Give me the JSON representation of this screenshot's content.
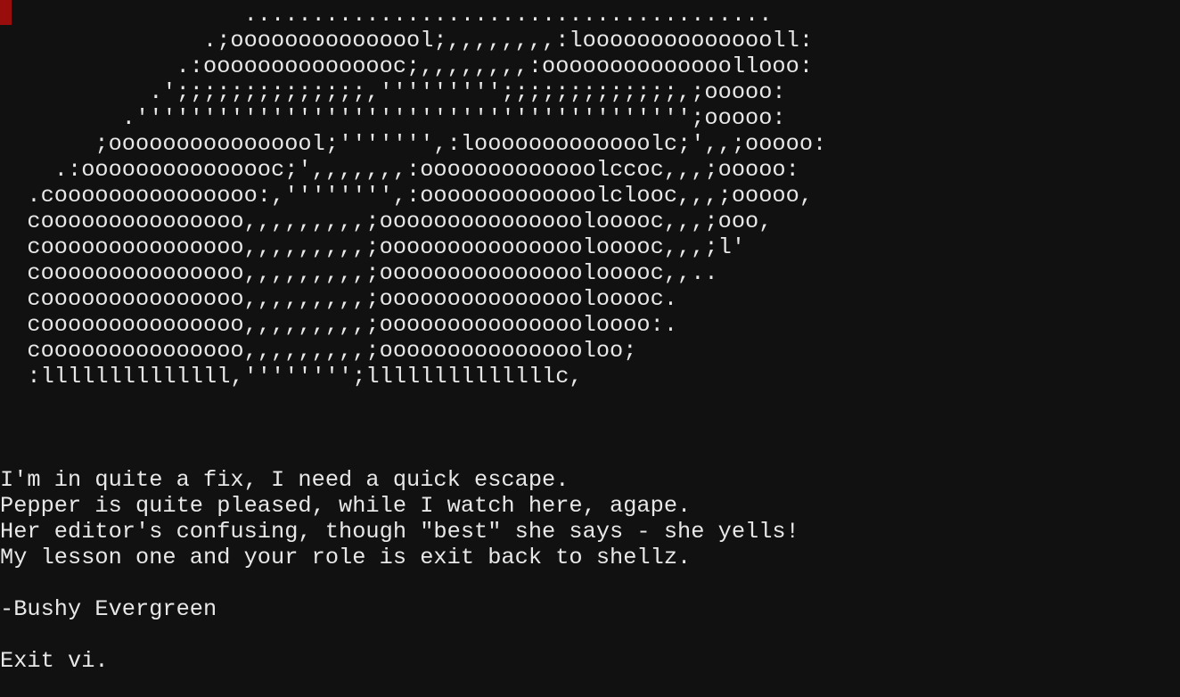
{
  "terminal": {
    "background": "#111111",
    "foreground": "#e8e8e8",
    "cursor_color": "#990d0d",
    "art": [
      "                  .......................................",
      "               .;ooooooooooooool;,,,,,,,,:looooooooooooooll:",
      "             .:ooooooooooooooc;,,,,,,,,:oooooooooooooollooo:",
      "           .';;;;;;;;;;;;;;,''''''''';;;;;;;;;;;;;,;ooooo:",
      "         .''''''''''''''''''''''''''''''''''''''''';ooooo:",
      "       ;oooooooooooooool;''''''',:looooooooooooolc;',,;ooooo:",
      "    .:ooooooooooooooc;',,,,,,,:ooooooooooooolccoc,,,;ooooo:",
      "  .cooooooooooooooo:,'''''''',:ooooooooooooolclooc,,,;ooooo,",
      "  cooooooooooooooo,,,,,,,,,;ooooooooooooooolooooc,,,;ooo,",
      "  cooooooooooooooo,,,,,,,,,;ooooooooooooooolooooc,,,;l'",
      "  cooooooooooooooo,,,,,,,,,;ooooooooooooooolooooc,,..",
      "  cooooooooooooooo,,,,,,,,,;ooooooooooooooolooooc.",
      "  cooooooooooooooo,,,,,,,,,;oooooooooooooooloooo:.",
      "  cooooooooooooooo,,,,,,,,,;oooooooooooooooloo;",
      "  :llllllllllllll,'''''''';llllllllllllllc,"
    ],
    "poem": [
      "I'm in quite a fix, I need a quick escape.",
      "Pepper is quite pleased, while I watch here, agape.",
      "Her editor's confusing, though \"best\" she says - she yells!",
      "My lesson one and your role is exit back to shellz."
    ],
    "signature": "-Bushy Evergreen",
    "task": "Exit vi."
  }
}
